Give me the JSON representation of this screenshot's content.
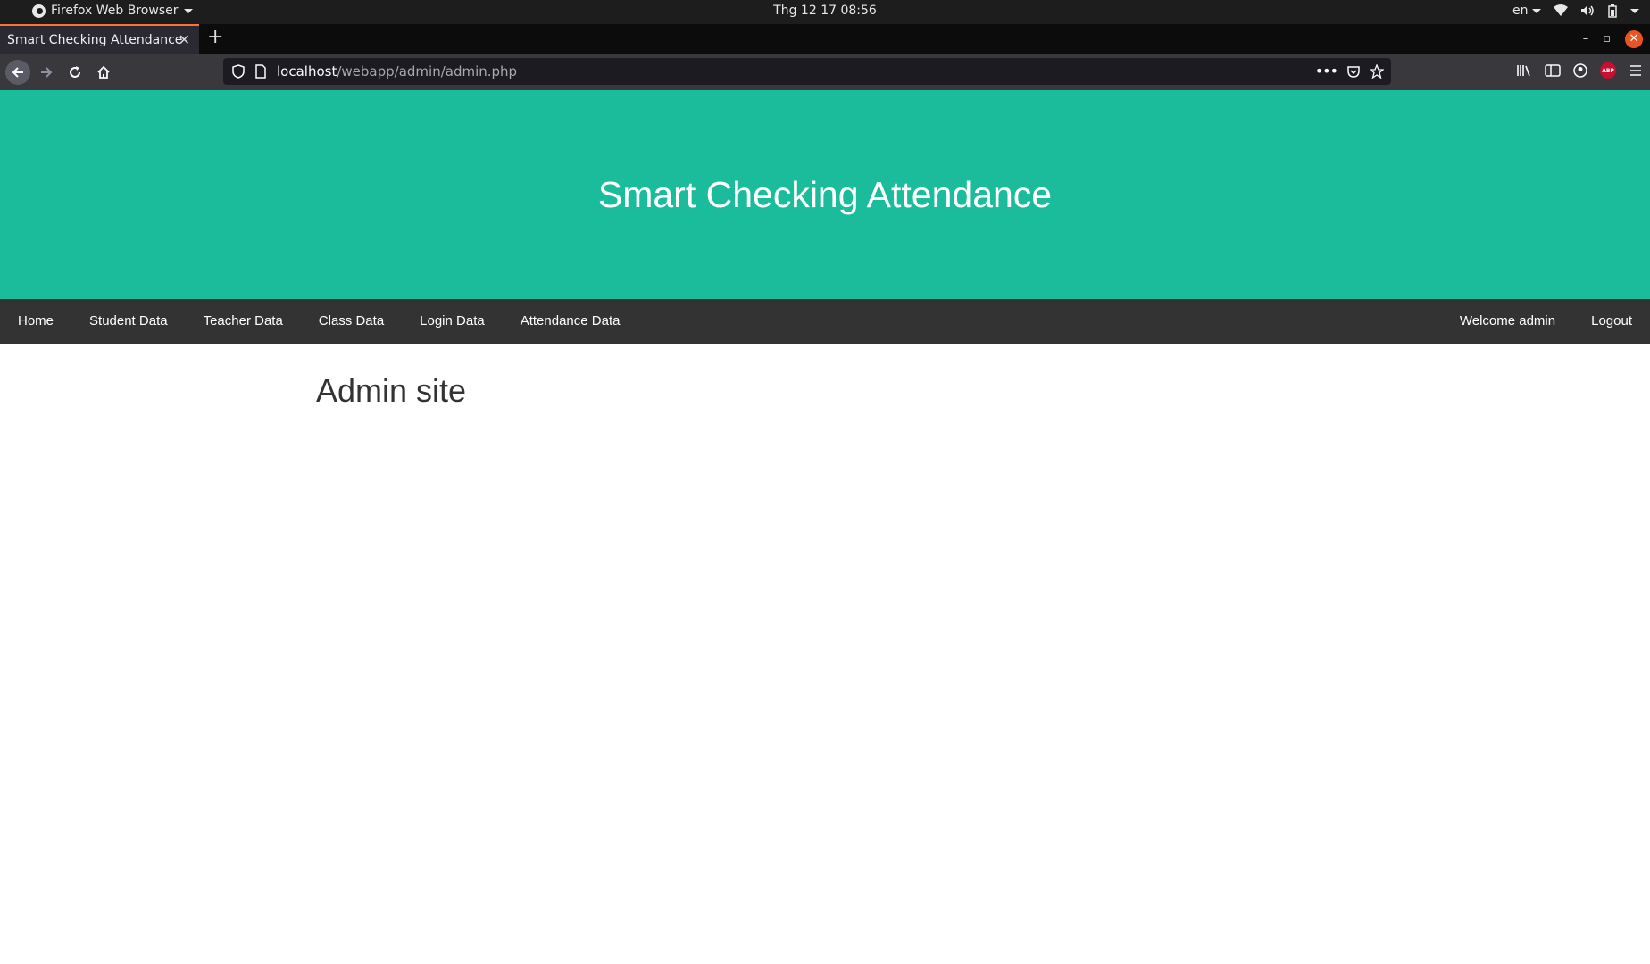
{
  "system": {
    "app_menu": "Firefox Web Browser",
    "clock": "Thg 12 17  08:56",
    "lang": "en"
  },
  "browser": {
    "tab_title": "Smart Checking Attendance",
    "url_host": "localhost",
    "url_path": "/webapp/admin/admin.php"
  },
  "header": {
    "title": "Smart Checking Attendance"
  },
  "nav": {
    "items": [
      "Home",
      "Student Data",
      "Teacher Data",
      "Class Data",
      "Login Data",
      "Attendance Data"
    ],
    "welcome": "Welcome admin",
    "logout": "Logout"
  },
  "main": {
    "heading": "Admin site"
  },
  "colors": {
    "hero": "#1abc9c",
    "menu": "#333333"
  }
}
